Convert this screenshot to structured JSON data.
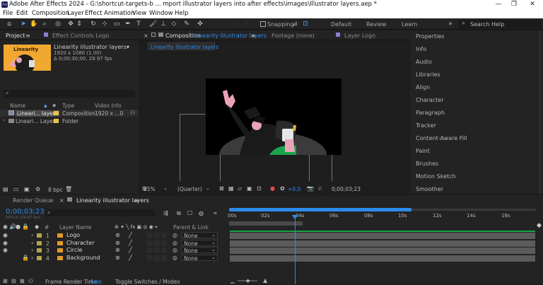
{
  "window": {
    "title": "Adobe After Effects 2024 - G:\\shortcut-targets-b ... mport illustrator layers into after effects\\images\\Illustrator layers.aep *"
  },
  "menu": [
    "File",
    "Edit",
    "Composition",
    "Layer",
    "Effect",
    "Animation",
    "View",
    "Window",
    "Help"
  ],
  "toolbar": {
    "snapping": "Snapping",
    "workspaces": [
      "Default",
      "Review",
      "Learn"
    ],
    "search_placeholder": "Search Help"
  },
  "project": {
    "tab": "Project",
    "effect_controls": "Effect Controls Logo",
    "selected_name": "Linearity illustrator layers▾",
    "info_line1": "1920 x 1080 (1.00)",
    "info_line2": "Δ 0;00;30;00, 29.97 fps",
    "thumb_text": "Linearity",
    "col_name": "Name",
    "col_type": "Type",
    "col_video": "Video Info",
    "items": [
      {
        "name": "Lineari... layers",
        "type": "Composition",
        "info": "1920 x ...0"
      },
      {
        "name": "Lineari... Layers",
        "type": "Folder",
        "info": ""
      }
    ],
    "bpc": "8 bpc"
  },
  "composition": {
    "tab": "Composition",
    "tab_name": "Linearity illustrator layers",
    "breadcrumb": "Linearity illustrator layers",
    "footage": "Footage (none)",
    "layer": "Layer Logo",
    "zoom": "25%",
    "resolution": "(Quarter)",
    "exposure": "+0,0",
    "timecode": "0;00;03;23"
  },
  "right_panels": [
    "Properties",
    "Info",
    "Audio",
    "Libraries",
    "Align",
    "Character",
    "Paragraph",
    "Tracker",
    "Content-Aware Fill",
    "Paint",
    "Brushes",
    "Motion Sketch",
    "Smoother"
  ],
  "timeline": {
    "render_queue": "Render Queue",
    "tab": "Linearity illustrator layers",
    "current_time": "0;00;03;23",
    "frames": "00113 (29.97 fps)",
    "col_hash": "#",
    "col_layer": "Layer Name",
    "col_parent": "Parent & Link",
    "ruler": [
      "00s",
      "02s",
      "04s",
      "06s",
      "08s",
      "10s",
      "12s",
      "14s",
      "16s"
    ],
    "playhead_fraction": 0.23,
    "layers": [
      {
        "num": "1",
        "name": "Logo",
        "parent": "None",
        "color": "#b9a34a"
      },
      {
        "num": "2",
        "name": "Character",
        "parent": "None",
        "color": "#b9a34a"
      },
      {
        "num": "3",
        "name": "Circle",
        "parent": "None",
        "color": "#b9a34a"
      },
      {
        "num": "4",
        "name": "Background",
        "parent": "None",
        "color": "#b9a34a"
      }
    ],
    "frame_render_label": "Frame Render Time:",
    "frame_render_value": "1ms",
    "toggle": "Toggle Switches / Modes"
  },
  "colors": {
    "accent": "#2d8ceb",
    "thumb_bg": "#f0a830",
    "comp_green": "#1aa34a"
  }
}
